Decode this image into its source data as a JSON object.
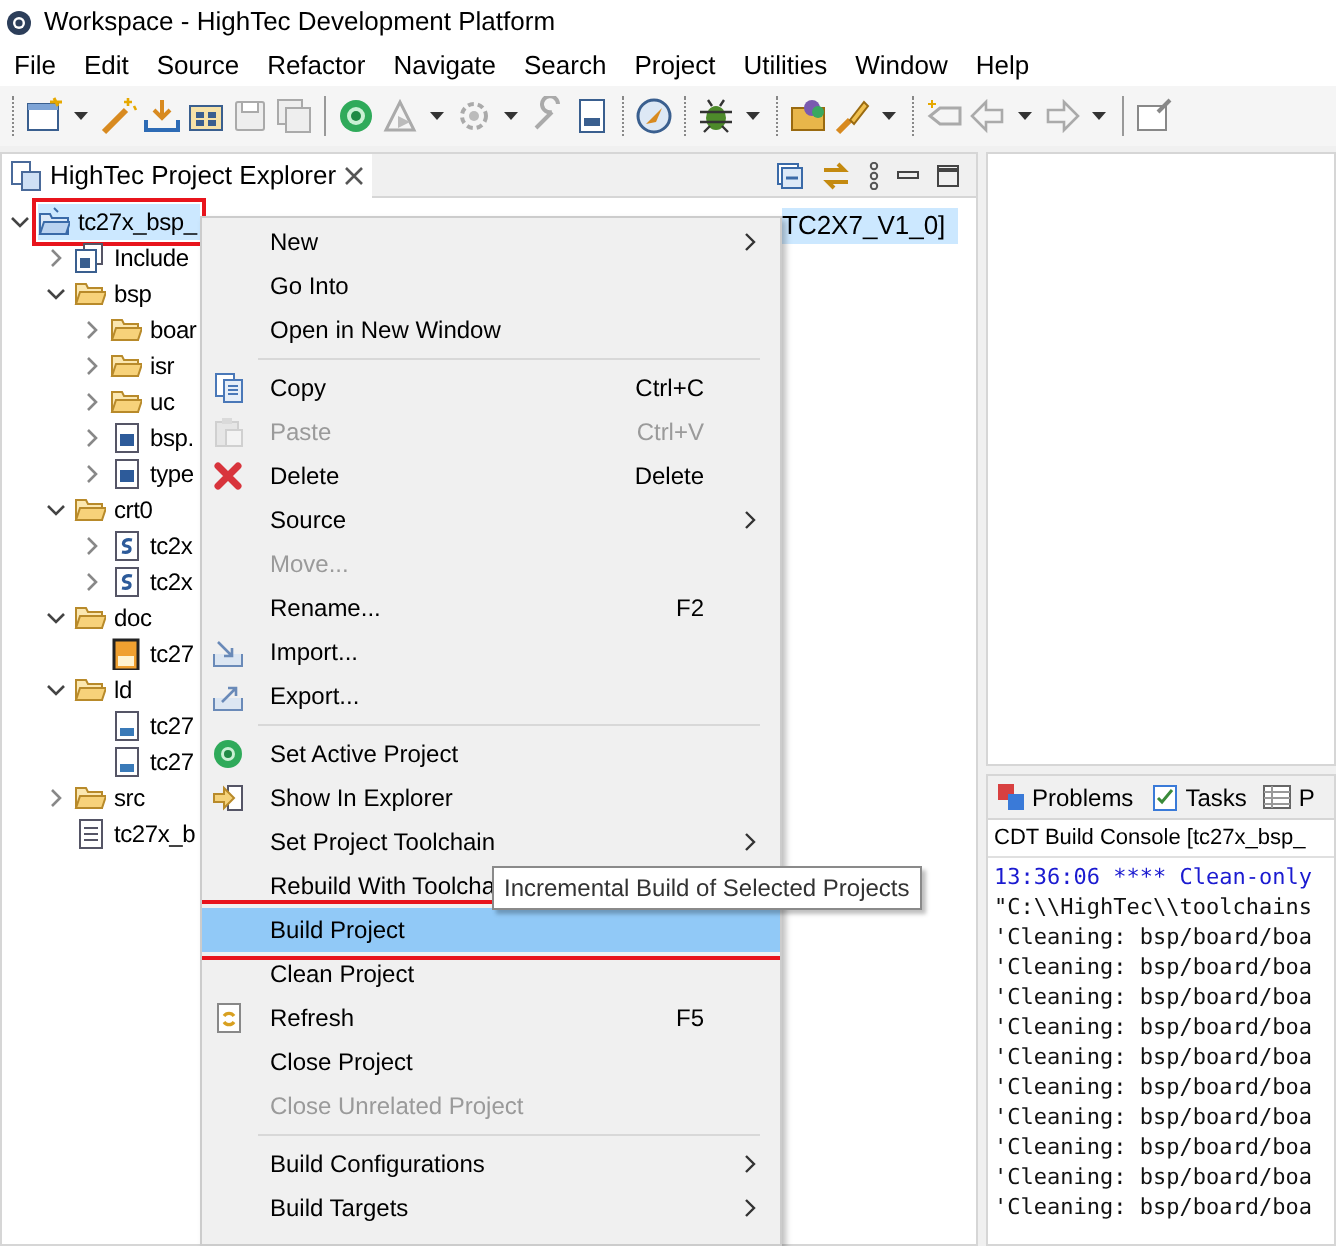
{
  "window": {
    "title": "Workspace - HighTec Development Platform"
  },
  "menu_bar": [
    "File",
    "Edit",
    "Source",
    "Refactor",
    "Navigate",
    "Search",
    "Project",
    "Utilities",
    "Window",
    "Help"
  ],
  "explorer": {
    "title": "HighTec Project Explorer",
    "tree": [
      {
        "kind": "project",
        "label": "tc27x_bsp_",
        "tail": "TC2X7_V1_0]",
        "expanded": true,
        "selected": true,
        "annotated": true,
        "children": [
          {
            "kind": "includes",
            "label": "Include",
            "expanded": false,
            "selected": false,
            "annotated": false
          },
          {
            "kind": "folder",
            "label": "bsp",
            "expanded": true,
            "selected": false,
            "annotated": false,
            "children": [
              {
                "kind": "folder",
                "label": "boar",
                "expanded": false,
                "selected": false,
                "annotated": false
              },
              {
                "kind": "folder",
                "label": "isr",
                "expanded": false,
                "selected": false,
                "annotated": false
              },
              {
                "kind": "folder",
                "label": "uc",
                "expanded": false,
                "selected": false,
                "annotated": false
              },
              {
                "kind": "header",
                "label": "bsp.",
                "expanded": false,
                "selected": false,
                "annotated": false
              },
              {
                "kind": "header",
                "label": "type",
                "expanded": false,
                "selected": false,
                "annotated": false
              }
            ]
          },
          {
            "kind": "folder",
            "label": "crt0",
            "expanded": true,
            "selected": false,
            "annotated": false,
            "children": [
              {
                "kind": "asm",
                "label": "tc2x",
                "expanded": false,
                "selected": false,
                "annotated": false
              },
              {
                "kind": "asm",
                "label": "tc2x",
                "expanded": false,
                "selected": false,
                "annotated": false
              }
            ]
          },
          {
            "kind": "folder",
            "label": "doc",
            "expanded": true,
            "selected": false,
            "annotated": false,
            "children": [
              {
                "kind": "pdf",
                "label": "tc27",
                "selected": false,
                "annotated": false
              }
            ]
          },
          {
            "kind": "folder",
            "label": "ld",
            "expanded": true,
            "selected": false,
            "annotated": false,
            "children": [
              {
                "kind": "ld",
                "label": "tc27",
                "selected": false,
                "annotated": false
              },
              {
                "kind": "ld",
                "label": "tc27",
                "selected": false,
                "annotated": false
              }
            ]
          },
          {
            "kind": "folder",
            "label": "src",
            "expanded": false,
            "selected": false,
            "annotated": false
          },
          {
            "kind": "text",
            "label": "tc27x_b",
            "selected": false,
            "annotated": false
          }
        ]
      }
    ]
  },
  "context_menu": [
    {
      "kind": "plain",
      "label": "New",
      "submenu": true,
      "disabled": false,
      "selected": false,
      "annotated": false
    },
    {
      "kind": "plain",
      "label": "Go Into",
      "submenu": false,
      "disabled": false,
      "selected": false,
      "annotated": false
    },
    {
      "kind": "plain",
      "label": "Open in New Window",
      "submenu": false,
      "disabled": false,
      "selected": false,
      "annotated": false
    },
    {
      "kind": "separator"
    },
    {
      "kind": "copy",
      "label": "Copy",
      "shortcut": "Ctrl+C",
      "submenu": false,
      "disabled": false,
      "selected": false,
      "annotated": false
    },
    {
      "kind": "paste",
      "label": "Paste",
      "shortcut": "Ctrl+V",
      "submenu": false,
      "disabled": true,
      "selected": false,
      "annotated": false
    },
    {
      "kind": "delete",
      "label": "Delete",
      "shortcut": "Delete",
      "submenu": false,
      "disabled": false,
      "selected": false,
      "annotated": false
    },
    {
      "kind": "plain",
      "label": "Source",
      "submenu": true,
      "disabled": false,
      "selected": false,
      "annotated": false
    },
    {
      "kind": "plain",
      "label": "Move...",
      "submenu": false,
      "disabled": true,
      "selected": false,
      "annotated": false
    },
    {
      "kind": "plain",
      "label": "Rename...",
      "shortcut": "F2",
      "submenu": false,
      "disabled": false,
      "selected": false,
      "annotated": false
    },
    {
      "kind": "import",
      "label": "Import...",
      "submenu": false,
      "disabled": false,
      "selected": false,
      "annotated": false
    },
    {
      "kind": "export",
      "label": "Export...",
      "submenu": false,
      "disabled": false,
      "selected": false,
      "annotated": false
    },
    {
      "kind": "separator"
    },
    {
      "kind": "active",
      "label": "Set Active Project",
      "submenu": false,
      "disabled": false,
      "selected": false,
      "annotated": false
    },
    {
      "kind": "show",
      "label": "Show In Explorer",
      "submenu": false,
      "disabled": false,
      "selected": false,
      "annotated": false
    },
    {
      "kind": "plain",
      "label": "Set Project Toolchain",
      "submenu": true,
      "disabled": false,
      "selected": false,
      "annotated": false
    },
    {
      "kind": "plain",
      "label": "Rebuild With Toolcha",
      "disabled": false,
      "selected": false
    },
    {
      "kind": "plain",
      "label": "Build Project",
      "submenu": false,
      "disabled": false,
      "selected": true,
      "annotated": true
    },
    {
      "kind": "plain",
      "label": "Clean Project",
      "submenu": false,
      "disabled": false,
      "selected": false,
      "annotated": false
    },
    {
      "kind": "refresh",
      "label": "Refresh",
      "shortcut": "F5",
      "submenu": false,
      "disabled": false,
      "selected": false,
      "annotated": false
    },
    {
      "kind": "plain",
      "label": "Close Project",
      "submenu": false,
      "disabled": false,
      "selected": false,
      "annotated": false
    },
    {
      "kind": "plain",
      "label": "Close Unrelated Project",
      "submenu": false,
      "disabled": true,
      "selected": false,
      "annotated": false
    },
    {
      "kind": "separator"
    },
    {
      "kind": "plain",
      "label": "Build Configurations",
      "submenu": true,
      "disabled": false,
      "selected": false,
      "annotated": false
    },
    {
      "kind": "plain",
      "label": "Build Targets",
      "submenu": true,
      "disabled": false,
      "selected": false,
      "annotated": false
    }
  ],
  "tooltip": "Incremental Build of Selected Projects",
  "bottom_panel": {
    "tabs": [
      {
        "kind": "problems",
        "label": "Problems",
        "selected": false
      },
      {
        "kind": "tasks",
        "label": "Tasks",
        "selected": false
      },
      {
        "kind": "properties",
        "label": "P",
        "selected": false
      }
    ],
    "console_title": "CDT Build Console [tc27x_bsp_",
    "lines": [
      {
        "kind": "info",
        "text": "13:36:06 **** Clean-only"
      },
      {
        "kind": "output",
        "text": "\"C:\\\\HighTec\\\\toolchains"
      },
      {
        "kind": "output",
        "text": "'Cleaning: bsp/board/boa"
      },
      {
        "kind": "output",
        "text": "'Cleaning: bsp/board/boa"
      },
      {
        "kind": "output",
        "text": "'Cleaning: bsp/board/boa"
      },
      {
        "kind": "output",
        "text": "'Cleaning: bsp/board/boa"
      },
      {
        "kind": "output",
        "text": "'Cleaning: bsp/board/boa"
      },
      {
        "kind": "output",
        "text": "'Cleaning: bsp/board/boa"
      },
      {
        "kind": "output",
        "text": "'Cleaning: bsp/board/boa"
      },
      {
        "kind": "output",
        "text": "'Cleaning: bsp/board/boa"
      },
      {
        "kind": "output",
        "text": "'Cleaning: bsp/board/boa"
      },
      {
        "kind": "output",
        "text": "'Cleaning: bsp/board/boa"
      }
    ]
  }
}
